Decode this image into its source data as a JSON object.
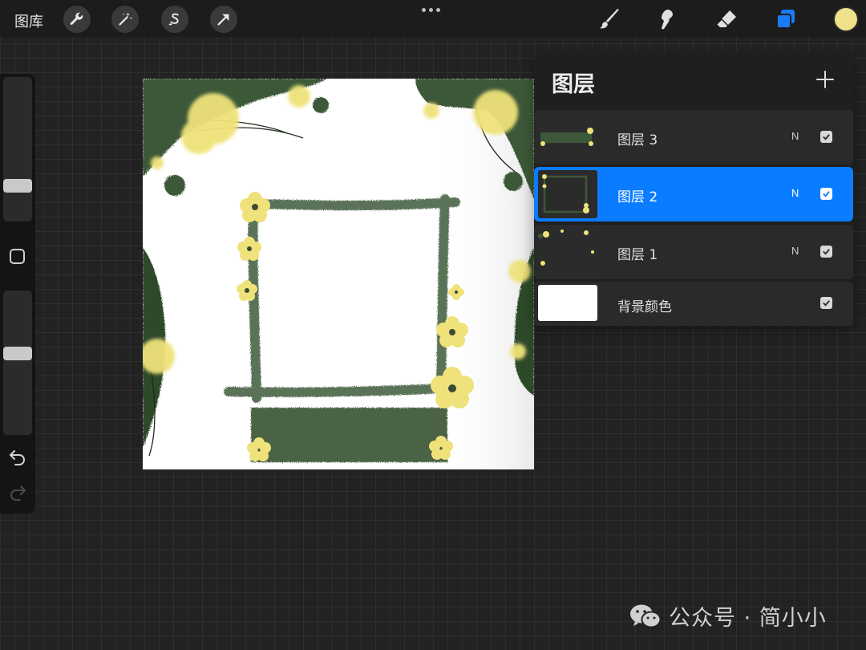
{
  "toolbar": {
    "gallery_label": "图库",
    "left_tools": [
      "wrench-icon",
      "magic-wand-icon",
      "selection-s-icon",
      "transform-arrow-icon"
    ],
    "right_tools": [
      "brush-icon",
      "smudge-icon",
      "eraser-icon",
      "layers-icon"
    ],
    "current_color": "#efe08a",
    "active_tool_color": "#1a7cf5"
  },
  "layers_panel": {
    "title": "图层",
    "add_icon": "plus-icon",
    "layers": [
      {
        "name": "图层 3",
        "blend": "N",
        "visible": true,
        "active": false
      },
      {
        "name": "图层 2",
        "blend": "N",
        "visible": true,
        "active": true
      },
      {
        "name": "图层 1",
        "blend": "N",
        "visible": true,
        "active": false
      },
      {
        "name": "背景颜色",
        "blend": "",
        "visible": true,
        "active": false
      }
    ]
  },
  "sidebar": {
    "brush_size_level": 0.22,
    "opacity_level": 0.57,
    "icons": [
      "square-modify-icon",
      "undo-icon",
      "redo-icon"
    ]
  },
  "colors": {
    "leaf_green": "#3d5838",
    "flower_yellow": "#efe27a",
    "accent_blue": "#0a7cff"
  },
  "watermark": {
    "text": "公众号 · 简小小",
    "icon": "wechat-icon"
  }
}
